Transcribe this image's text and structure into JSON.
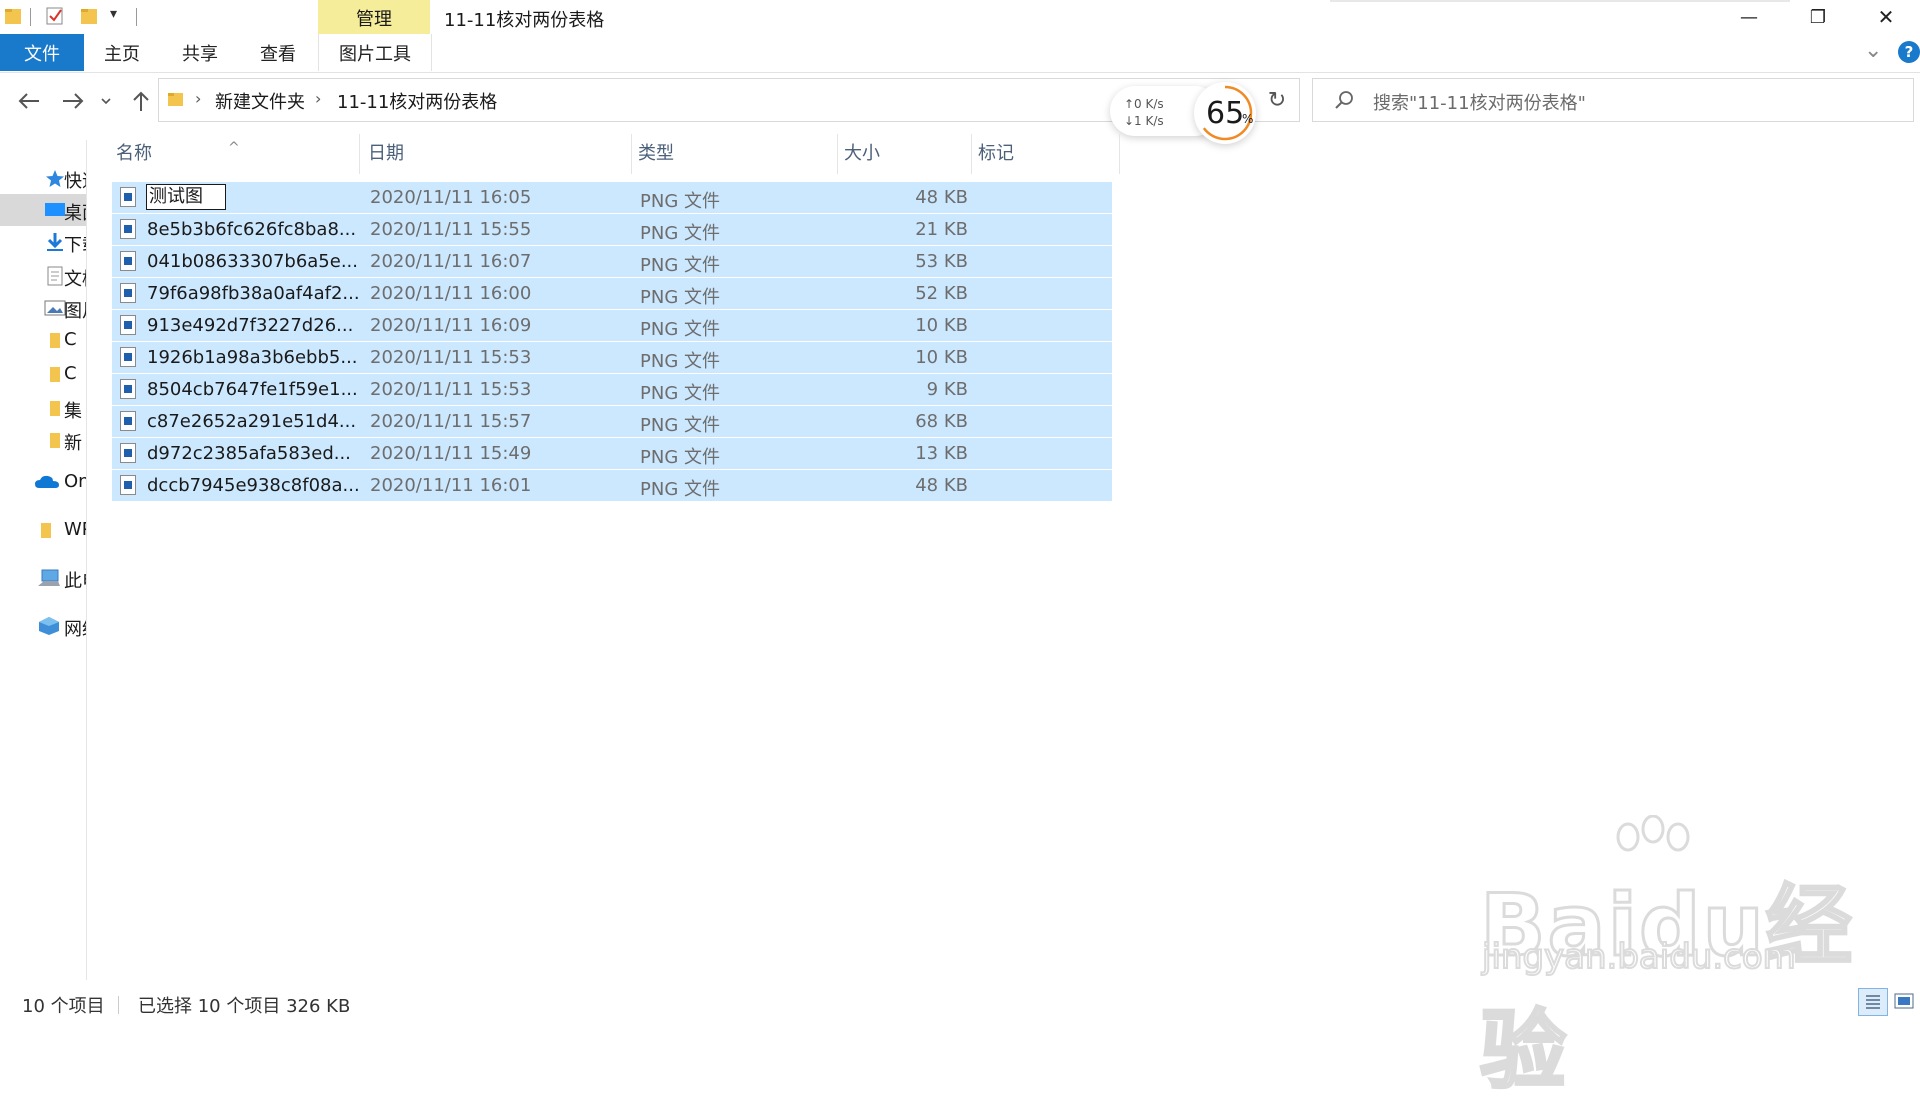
{
  "titlebar": {
    "manage_tab": "管理",
    "window_title": "11-11核对两份表格",
    "minimize_glyph": "—",
    "restore_glyph": "❐",
    "close_glyph": "✕"
  },
  "ribbon": {
    "tabs": [
      {
        "label": "文件"
      },
      {
        "label": "主页"
      },
      {
        "label": "共享"
      },
      {
        "label": "查看"
      },
      {
        "label": "图片工具"
      }
    ],
    "collapse_glyph": "⌄",
    "help_glyph": "?"
  },
  "navigation": {
    "back_icon": "arrow-left-icon",
    "forward_icon": "arrow-right-icon",
    "recent_icon": "chevron-down-icon",
    "up_icon": "arrow-up-icon",
    "breadcrumb": [
      "新建文件夹",
      "11-11核对两份表格"
    ],
    "refresh_glyph": "↻"
  },
  "search": {
    "placeholder": "搜索\"11-11核对两份表格\""
  },
  "speed_widget": {
    "upload": "↑0  K/s",
    "download": "↓1  K/s",
    "percent": "65",
    "percent_sign": "%",
    "percent_value": 65,
    "ring_color": "#f08a24"
  },
  "nav_pane": {
    "items": [
      {
        "label": "快速访问",
        "icon": "star-icon"
      },
      {
        "label": "桌面",
        "icon": "desktop-icon"
      },
      {
        "label": "下载",
        "icon": "download-icon"
      },
      {
        "label": "文档",
        "icon": "document-icon"
      },
      {
        "label": "图片",
        "icon": "picture-icon"
      },
      {
        "label": "C",
        "icon": "folder-icon"
      },
      {
        "label": "C",
        "icon": "folder-icon"
      },
      {
        "label": "集",
        "icon": "folder-icon"
      },
      {
        "label": "新",
        "icon": "folder-icon"
      },
      {
        "label": "OneDrive",
        "icon": "cloud-icon"
      },
      {
        "label": "WPS",
        "icon": "folder-icon"
      },
      {
        "label": "此电脑",
        "icon": "computer-icon"
      },
      {
        "label": "网络",
        "icon": "network-icon"
      }
    ]
  },
  "file_list": {
    "columns": [
      "名称",
      "日期",
      "类型",
      "大小",
      "标记"
    ],
    "sort_glyph": "^",
    "rows": [
      {
        "name": "测试图",
        "date": "2020/11/11 16:05",
        "type": "PNG 文件",
        "size": "48 KB",
        "renaming": true
      },
      {
        "name": "8e5b3b6fc626fc8ba8...",
        "date": "2020/11/11 15:55",
        "type": "PNG 文件",
        "size": "21 KB"
      },
      {
        "name": "041b08633307b6a5e...",
        "date": "2020/11/11 16:07",
        "type": "PNG 文件",
        "size": "53 KB"
      },
      {
        "name": "79f6a98fb38a0af4af2...",
        "date": "2020/11/11 16:00",
        "type": "PNG 文件",
        "size": "52 KB"
      },
      {
        "name": "913e492d7f3227d26...",
        "date": "2020/11/11 16:09",
        "type": "PNG 文件",
        "size": "10 KB"
      },
      {
        "name": "1926b1a98a3b6ebb5...",
        "date": "2020/11/11 15:53",
        "type": "PNG 文件",
        "size": "10 KB"
      },
      {
        "name": "8504cb7647fe1f59e1...",
        "date": "2020/11/11 15:53",
        "type": "PNG 文件",
        "size": "9 KB"
      },
      {
        "name": "c87e2652a291e51d4...",
        "date": "2020/11/11 15:57",
        "type": "PNG 文件",
        "size": "68 KB"
      },
      {
        "name": "d972c2385afa583ed...",
        "date": "2020/11/11 15:49",
        "type": "PNG 文件",
        "size": "13 KB"
      },
      {
        "name": "dccb7945e938c8f08a...",
        "date": "2020/11/11 16:01",
        "type": "PNG 文件",
        "size": "48 KB"
      }
    ]
  },
  "status": {
    "item_count": "10 个项目",
    "selection": "已选择 10 个项目  326 KB"
  },
  "watermark": {
    "main": "Baidu经验",
    "sub": "jingyan.baidu.com"
  },
  "colors": {
    "selection": "#cce8ff",
    "file_tab": "#1979ca",
    "manage_tab": "#f5ed99",
    "help": "#1979ca"
  }
}
